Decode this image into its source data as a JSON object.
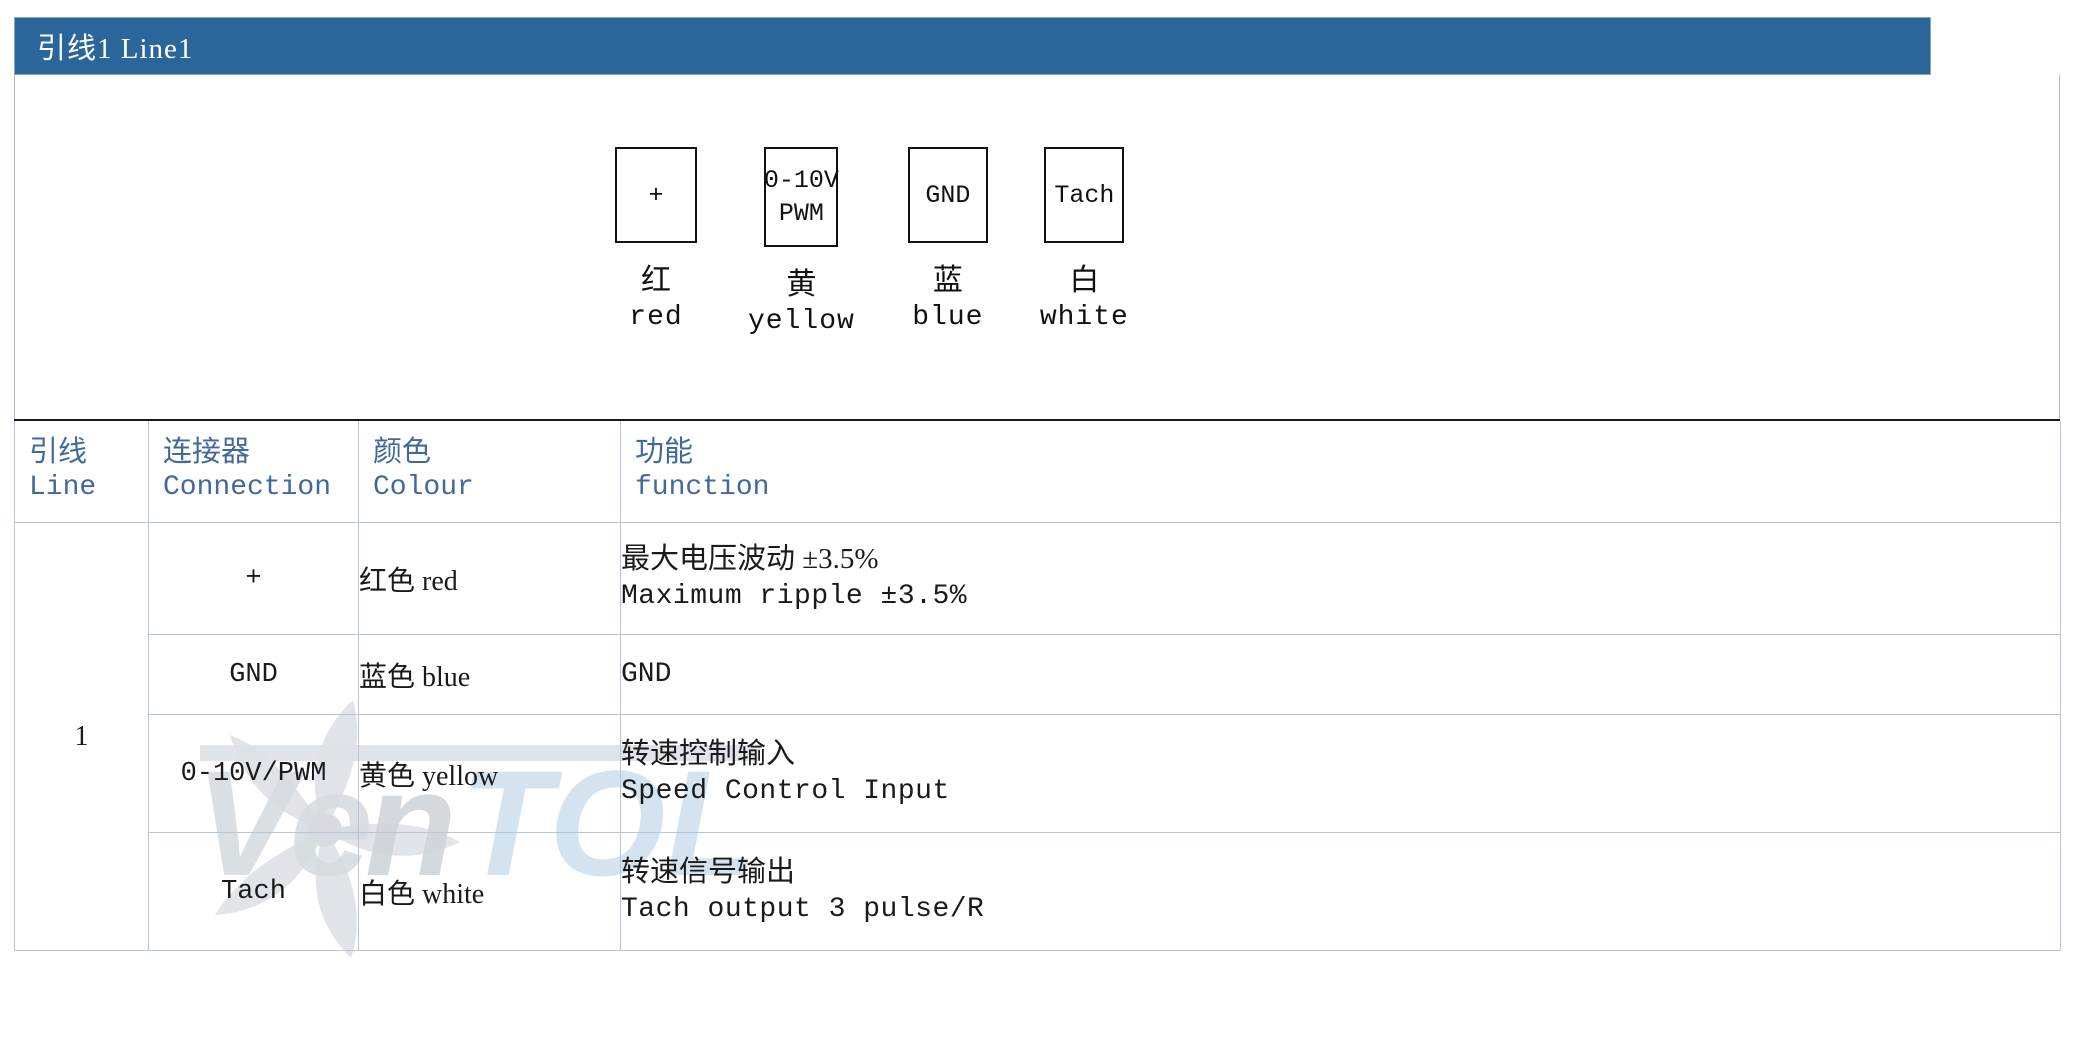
{
  "banner": {
    "title": "引线1 Line1"
  },
  "diagram": {
    "connectors": [
      {
        "box_lines": [
          "+"
        ],
        "label_cn": "红",
        "label_en": "red",
        "icon": "connector-pin-box"
      },
      {
        "box_lines": [
          "0-10V",
          "PWM"
        ],
        "label_cn": "黄",
        "label_en": "yellow",
        "icon": "connector-pin-box"
      },
      {
        "box_lines": [
          "GND"
        ],
        "label_cn": "蓝",
        "label_en": "blue",
        "icon": "connector-pin-box"
      },
      {
        "box_lines": [
          "Tach"
        ],
        "label_cn": "白",
        "label_en": "white",
        "icon": "connector-pin-box"
      }
    ]
  },
  "table": {
    "header_color": "#41699c",
    "border_color": "#b6c6d6",
    "columns": [
      {
        "cn": "引线",
        "en": "Line"
      },
      {
        "cn": "连接器",
        "en": "Connection"
      },
      {
        "cn": "颜色",
        "en": "Colour"
      },
      {
        "cn": "功能",
        "en": "function"
      }
    ],
    "line_number": "1",
    "rows": [
      {
        "connection": "+",
        "colour": "红色 red",
        "function_cn": "最大电压波动 ±3.5%",
        "function_en": "Maximum ripple ±3.5%"
      },
      {
        "connection": "GND",
        "colour": "蓝色 blue",
        "function_cn": "",
        "function_en": "GND"
      },
      {
        "connection": "0-10V/PWM",
        "colour": "黄色 yellow",
        "function_cn": "转速控制输入",
        "function_en": "Speed Control Input"
      },
      {
        "connection": "Tach",
        "colour": "白色 white",
        "function_cn": "转速信号输出",
        "function_en": "Tach output 3 pulse/R"
      }
    ]
  },
  "watermark": {
    "text": "VeNTOL",
    "gray": "#d8dde2",
    "blue": "#cfe0ef"
  },
  "colors": {
    "banner_blue": "#2a6699",
    "header_text_blue": "#41699c",
    "rule_black": "#1a1a1a"
  }
}
